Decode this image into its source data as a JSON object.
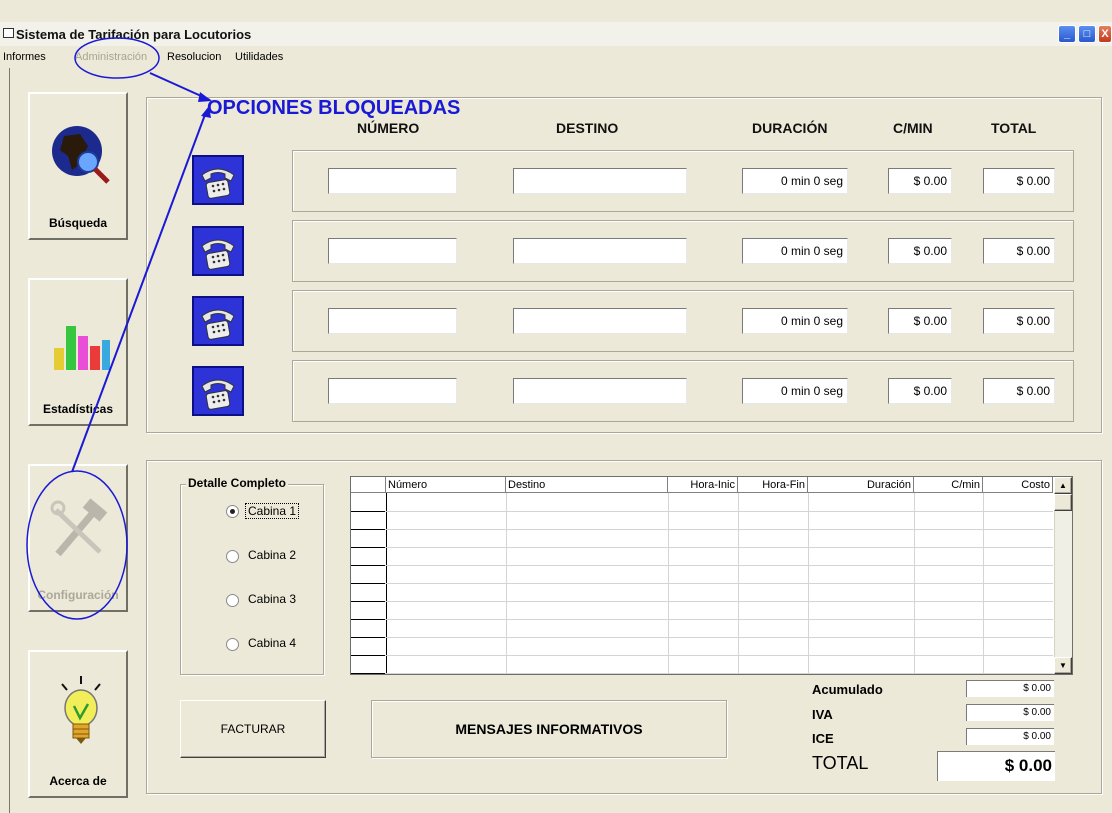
{
  "window": {
    "title": "Sistema de Tarifación para Locutorios"
  },
  "menu": [
    {
      "label": "Informes",
      "disabled": false
    },
    {
      "label": "Administración",
      "disabled": true
    },
    {
      "label": "Resolucion",
      "disabled": false
    },
    {
      "label": "Utilidades",
      "disabled": false
    }
  ],
  "annotation": {
    "text": "OPCIONES BLOQUEADAS",
    "color": "#1a1ad6"
  },
  "sidebar": {
    "busqueda": "Búsqueda",
    "estadisticas": "Estadísticas",
    "configuracion": "Configuración",
    "acerca": "Acerca de"
  },
  "headers": {
    "numero": "NÚMERO",
    "destino": "DESTINO",
    "duracion": "DURACIÓN",
    "cmin": "C/MIN",
    "total": "TOTAL"
  },
  "cabins": [
    {
      "numero": "",
      "destino": "",
      "duracion": "0 min 0 seg",
      "cmin": "$ 0.00",
      "total": "$ 0.00"
    },
    {
      "numero": "",
      "destino": "",
      "duracion": "0 min 0 seg",
      "cmin": "$ 0.00",
      "total": "$ 0.00"
    },
    {
      "numero": "",
      "destino": "",
      "duracion": "0 min 0 seg",
      "cmin": "$ 0.00",
      "total": "$ 0.00"
    },
    {
      "numero": "",
      "destino": "",
      "duracion": "0 min 0 seg",
      "cmin": "$ 0.00",
      "total": "$ 0.00"
    }
  ],
  "detalle": {
    "title": "Detalle Completo",
    "options": [
      "Cabina 1",
      "Cabina 2",
      "Cabina 3",
      "Cabina 4"
    ],
    "selected": "Cabina 1"
  },
  "grid": {
    "columns": [
      "Número",
      "Destino",
      "Hora-Inic",
      "Hora-Fin",
      "Duración",
      "C/min",
      "Costo"
    ]
  },
  "buttons": {
    "facturar": "FACTURAR"
  },
  "mensajes": "MENSAJES INFORMATIVOS",
  "totals": {
    "acumulado_label": "Acumulado",
    "acumulado": "$ 0.00",
    "iva_label": "IVA",
    "iva": "$ 0.00",
    "ice_label": "ICE",
    "ice": "$ 0.00",
    "total_label": "TOTAL",
    "total": "$ 0.00"
  }
}
